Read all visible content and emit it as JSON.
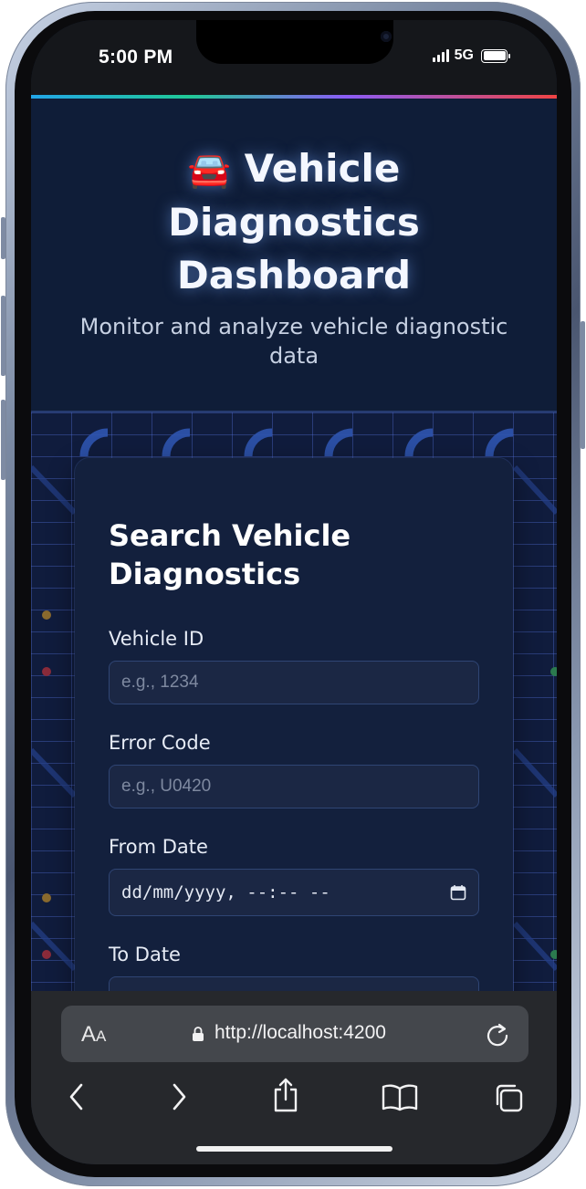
{
  "status_bar": {
    "time": "5:00 PM",
    "network": "5G"
  },
  "header": {
    "title_icon": "🚘",
    "title": "Vehicle Diagnostics Dashboard",
    "subtitle": "Monitor and analyze vehicle diagnostic data",
    "accent_gradient": [
      "#22a6e8",
      "#20c997",
      "#8b5cf6",
      "#ef4444"
    ]
  },
  "search_form": {
    "title": "Search Vehicle Diagnostics",
    "vehicle_id": {
      "label": "Vehicle ID",
      "placeholder": "e.g., 1234",
      "value": ""
    },
    "error_code": {
      "label": "Error Code",
      "placeholder": "e.g., U0420",
      "value": ""
    },
    "from_date": {
      "label": "From Date",
      "display": "dd/mm/yyyy, --:-- --"
    },
    "to_date": {
      "label": "To Date"
    }
  },
  "browser": {
    "text_size_label": "AA",
    "url": "http://localhost:4200",
    "icons": [
      "lock-icon",
      "reload-icon",
      "back-icon",
      "forward-icon",
      "share-icon",
      "bookmarks-icon",
      "tabs-icon"
    ]
  },
  "colors": {
    "page_bg": "#0f1c36",
    "card_bg": "#13203d",
    "input_bg": "#1b2744",
    "input_border": "#2f4574",
    "browser_bg": "#26282c"
  }
}
